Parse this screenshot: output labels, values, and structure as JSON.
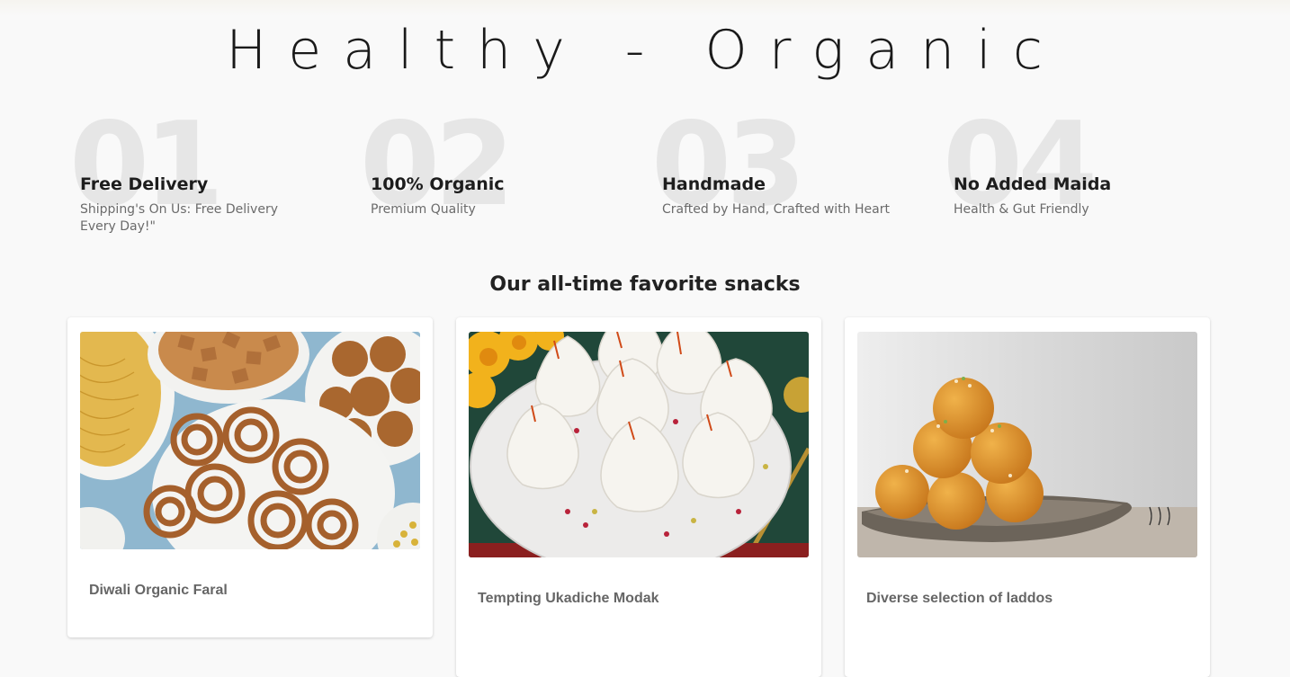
{
  "hero": {
    "title": "Healthy - Organic"
  },
  "features": [
    {
      "num": "01",
      "title": "Free Delivery",
      "desc": "Shipping's On Us: Free Delivery Every Day!\""
    },
    {
      "num": "02",
      "title": "100% Organic",
      "desc": "Premium Quality"
    },
    {
      "num": "03",
      "title": "Handmade",
      "desc": "Crafted by Hand, Crafted with Heart"
    },
    {
      "num": "04",
      "title": "No Added Maida",
      "desc": "Health & Gut Friendly"
    }
  ],
  "section": {
    "title": "Our all-time favorite snacks"
  },
  "products": [
    {
      "name": "Diwali Organic Faral",
      "image": "faral-snacks-photo"
    },
    {
      "name": "Tempting Ukadiche Modak",
      "image": "modak-photo"
    },
    {
      "name": "Diverse selection of laddos",
      "image": "laddoo-photo"
    }
  ]
}
